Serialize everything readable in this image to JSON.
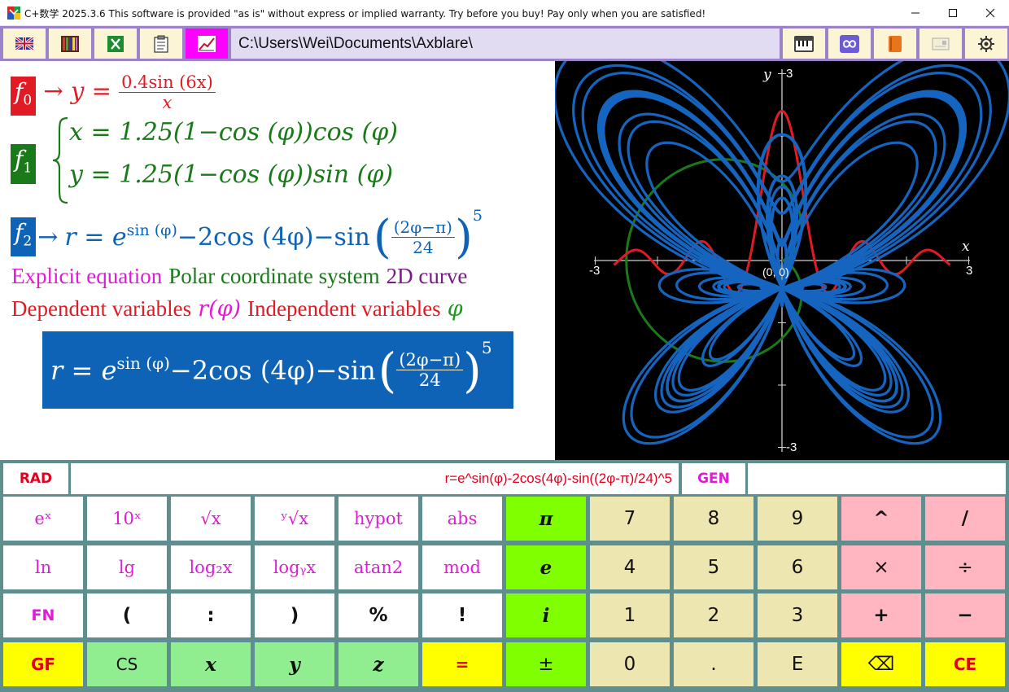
{
  "window": {
    "title": "C+数学 2025.3.6 This software is provided \"as is\" without express or implied warranty. Try before you buy! Pay only when you are satisfied!"
  },
  "toolbar": {
    "left_buttons": [
      "uk-flag-icon",
      "book-grid-icon",
      "excel-icon",
      "clipboard-icon",
      "chart-icon"
    ],
    "path": "C:\\Users\\Wei\\Documents\\Axblare\\",
    "right_buttons": [
      "piano-icon",
      "infinity-icon",
      "book-icon",
      "card-icon",
      "gear-icon"
    ],
    "active_color": "#ff00ff"
  },
  "formulas": {
    "f0": {
      "label": "f",
      "sub": "0",
      "arrow": "→",
      "lhs": "y",
      "eq": "=",
      "num": "0.4sin (6x)",
      "den": "x",
      "color": "#e01b24"
    },
    "f1": {
      "label": "f",
      "sub": "1",
      "line1": "x = 1.25(1−cos (φ))cos (φ)",
      "line2": "y = 1.25(1−cos (φ))sin (φ)",
      "color": "#1a7a1a"
    },
    "f2": {
      "label": "f",
      "sub": "2",
      "arrow": "→",
      "lhs": "r = e",
      "sup": "sin (φ)",
      "mid": "−2cos (4φ)−sin",
      "num": "(2φ−π)",
      "den": "24",
      "pow": "5",
      "color": "#0f63b6"
    }
  },
  "descriptions": {
    "line1": [
      {
        "text": "Explicit equation",
        "color": "#e01ad8"
      },
      {
        "text": "Polar coordinate system",
        "color": "#1a7a1a"
      },
      {
        "text": "2D curve",
        "color": "#7a1a8a"
      }
    ],
    "line2": [
      {
        "text": "Dependent variables",
        "color": "#e01b24"
      },
      {
        "text": "r(φ)",
        "color": "#e01ad8"
      },
      {
        "text": "Independent variables",
        "color": "#e01b24"
      },
      {
        "text": "φ",
        "color": "#1a9a1a"
      }
    ]
  },
  "preview": {
    "lhs": "r = e",
    "sup": "sin (φ)",
    "mid": "−2cos (4φ)−sin",
    "num": "(2φ−π)",
    "den": "24",
    "pow": "5"
  },
  "graph": {
    "x_label": "x",
    "y_label": "y",
    "x_min_label": "-3",
    "x_max_label": "3",
    "y_min_label": "-3",
    "y_max_label": "3",
    "origin_label": "(0, 0)",
    "range": [
      -3,
      3
    ],
    "curves": [
      {
        "name": "f0",
        "color": "#e01b24"
      },
      {
        "name": "f1",
        "color": "#1a7a1a"
      },
      {
        "name": "f2",
        "color": "#1565c0"
      }
    ]
  },
  "calculator": {
    "mode": "RAD",
    "input": "r=e^sin(φ)-2cos(4φ)-sin((2φ-π)/24)^5",
    "gen": "GEN",
    "extra": "",
    "keys": [
      [
        "eˣ",
        "10ˣ",
        "√x",
        "ʸ√x",
        "hypot",
        "abs",
        "π",
        "7",
        "8",
        "9",
        "^",
        "/"
      ],
      [
        "ln",
        "lg",
        "log₂x",
        "logᵧx",
        "atan2",
        "mod",
        "e",
        "4",
        "5",
        "6",
        "×",
        "÷"
      ],
      [
        "FN",
        "(",
        ":",
        ")",
        "%",
        "!",
        "i",
        "1",
        "2",
        "3",
        "+",
        "−"
      ],
      [
        "GF",
        "CS",
        "x",
        "y",
        "z",
        "=",
        "±",
        "0",
        ".",
        "E",
        "⌫",
        "CE"
      ]
    ]
  }
}
